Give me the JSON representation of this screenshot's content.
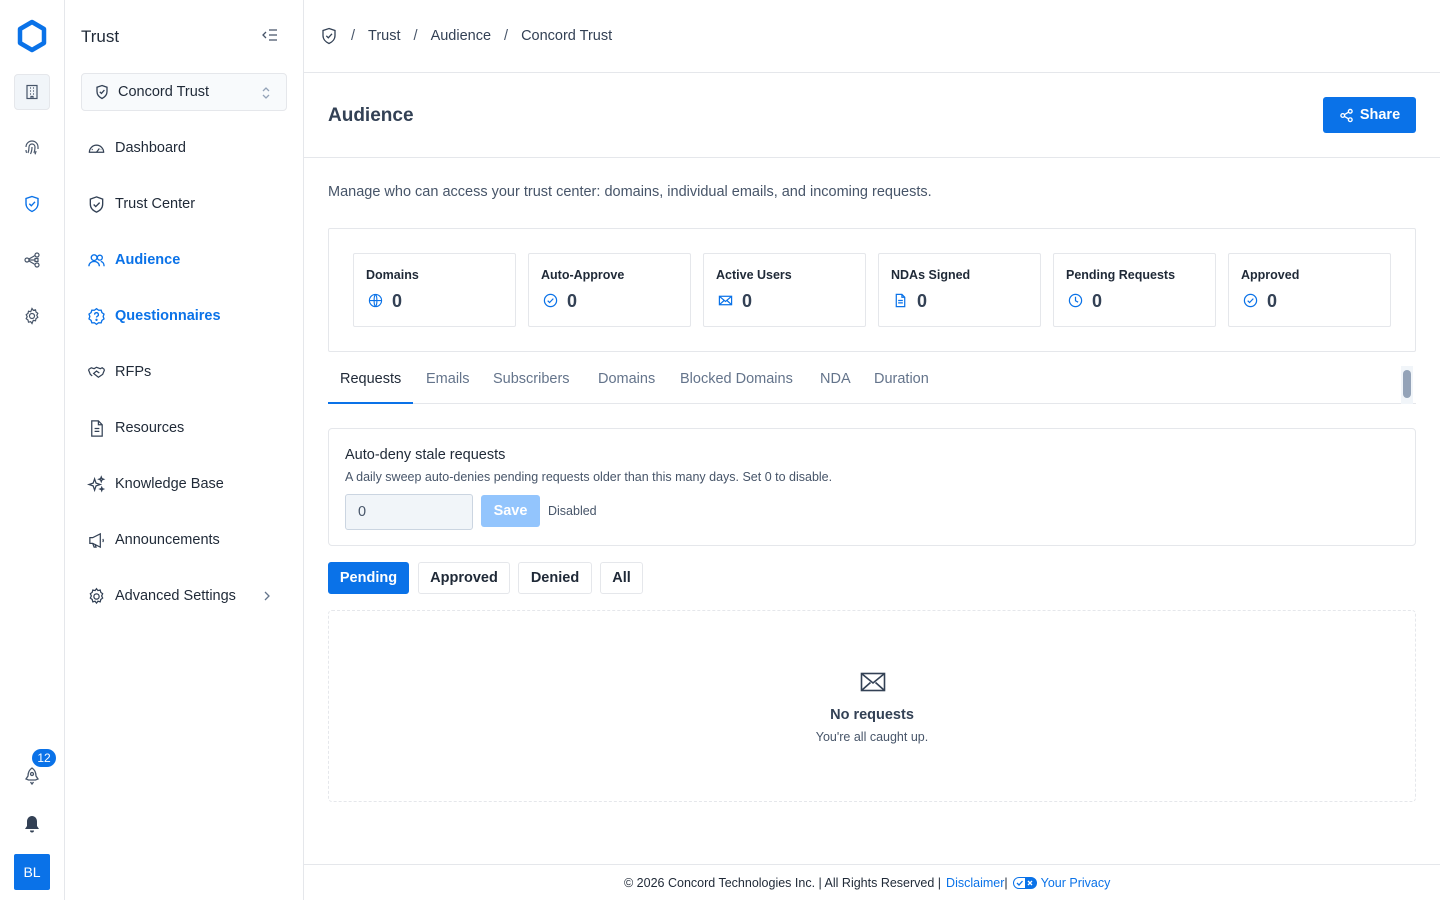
{
  "rail": {
    "notification_count": "12",
    "avatar_initials": "BL"
  },
  "sidebar": {
    "title": "Trust",
    "workspace": "Concord Trust",
    "items": [
      {
        "label": "Dashboard",
        "icon": "gauge-icon"
      },
      {
        "label": "Trust Center",
        "icon": "shield-check-icon"
      },
      {
        "label": "Audience",
        "icon": "users-icon",
        "active": true
      },
      {
        "label": "Questionnaires",
        "icon": "question-badge-icon"
      },
      {
        "label": "RFPs",
        "icon": "handshake-icon"
      },
      {
        "label": "Resources",
        "icon": "document-icon"
      },
      {
        "label": "Knowledge Base",
        "icon": "sparkles-icon"
      },
      {
        "label": "Announcements",
        "icon": "megaphone-icon"
      },
      {
        "label": "Advanced Settings",
        "icon": "gear-icon"
      }
    ]
  },
  "breadcrumb": {
    "items": [
      "Trust",
      "Audience",
      "Concord Trust"
    ]
  },
  "header": {
    "title": "Audience",
    "share_label": "Share"
  },
  "description": "Manage who can access your trust center: domains, individual emails, and incoming requests.",
  "stats": [
    {
      "label": "Domains",
      "value": "0",
      "icon": "globe-icon"
    },
    {
      "label": "Auto-Approve",
      "value": "0",
      "icon": "check-circle-icon"
    },
    {
      "label": "Active Users",
      "value": "0",
      "icon": "mail-icon"
    },
    {
      "label": "NDAs Signed",
      "value": "0",
      "icon": "document-icon"
    },
    {
      "label": "Pending Requests",
      "value": "0",
      "icon": "clock-icon"
    },
    {
      "label": "Approved",
      "value": "0",
      "icon": "check-circle-icon"
    }
  ],
  "tabs": [
    "Requests",
    "Emails",
    "Subscribers",
    "Domains",
    "Blocked Domains",
    "NDA",
    "Duration"
  ],
  "auto_deny": {
    "title": "Auto-deny stale requests",
    "subtitle": "A daily sweep auto-denies pending requests older than this many days. Set 0 to disable.",
    "value": "0",
    "save_label": "Save",
    "state": "Disabled"
  },
  "filters": [
    "Pending",
    "Approved",
    "Denied",
    "All"
  ],
  "empty": {
    "title": "No requests",
    "subtitle": "You're all caught up."
  },
  "footer": {
    "copyright": "© 2026 Concord Technologies Inc. | All Rights Reserved |",
    "disclaimer": "Disclaimer",
    "privacy": "Your Privacy"
  },
  "colors": {
    "accent": "#0a72e8",
    "border": "#e5e7eb"
  }
}
